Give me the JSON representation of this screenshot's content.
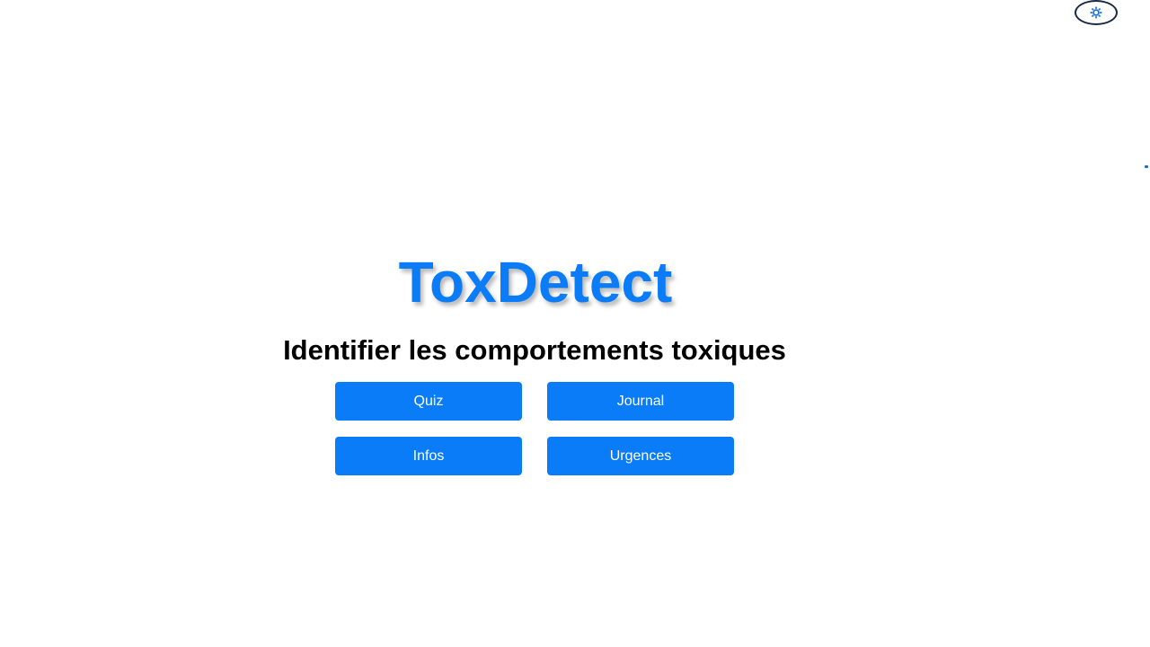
{
  "app": {
    "title": "ToxDetect",
    "subtitle": "Identifier les comportements toxiques"
  },
  "settings": {
    "icon": "gear-icon"
  },
  "menu": {
    "quiz_label": "Quiz",
    "journal_label": "Journal",
    "infos_label": "Infos",
    "urgences_label": "Urgences"
  },
  "colors": {
    "accent": "#0a7cf8",
    "settings_border": "#1a2a44",
    "text": "#000000",
    "background": "#ffffff"
  }
}
